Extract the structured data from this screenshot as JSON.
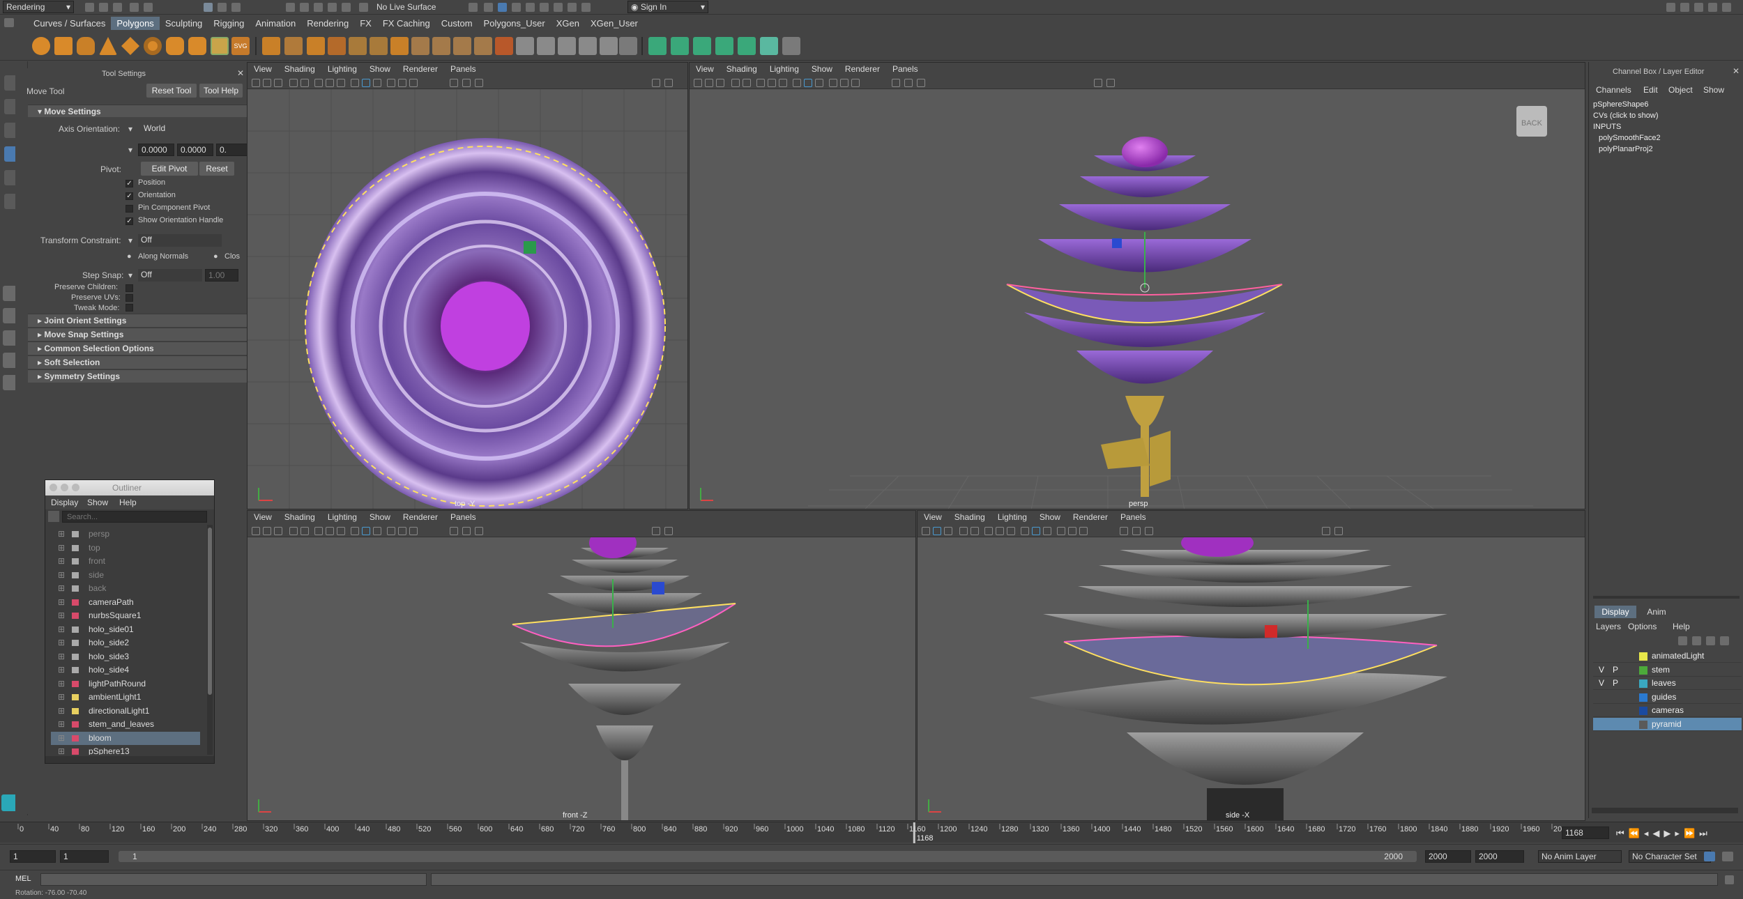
{
  "topbar": {
    "menu_set": "Rendering",
    "live_surface": "No Live Surface",
    "sign_in": "Sign In"
  },
  "shelf_tabs": [
    "Curves / Surfaces",
    "Polygons",
    "Sculpting",
    "Rigging",
    "Animation",
    "Rendering",
    "FX",
    "FX Caching",
    "Custom",
    "Polygons_User",
    "XGen",
    "XGen_User"
  ],
  "shelf_active": "Polygons",
  "tool_settings": {
    "header": "Tool Settings",
    "tool_name": "Move Tool",
    "reset_tool": "Reset Tool",
    "tool_help": "Tool Help",
    "section": "Move Settings",
    "axis_orientation_label": "Axis Orientation:",
    "axis_orientation": "World",
    "coord_x": "0.0000",
    "coord_y": "0.0000",
    "coord_z": "0.",
    "pivot_label": "Pivot:",
    "edit_pivot": "Edit Pivot",
    "reset": "Reset",
    "pivot_options": [
      "Position",
      "Orientation",
      "Pin Component Pivot",
      "Show Orientation Handle"
    ],
    "transform_constraint_label": "Transform Constraint:",
    "transform_constraint": "Off",
    "along_normals": "Along Normals",
    "closest": "Clos",
    "step_snap_label": "Step Snap:",
    "step_snap": "Off",
    "step_snap_value": "1.00",
    "preserve_children": "Preserve Children:",
    "preserve_uvs": "Preserve UVs:",
    "tweak_mode": "Tweak Mode:",
    "sections": [
      "Joint Orient Settings",
      "Move Snap Settings",
      "Common Selection Options",
      "Soft Selection",
      "Symmetry Settings"
    ]
  },
  "outliner": {
    "title": "Outliner",
    "menu": [
      "Display",
      "Show",
      "Help"
    ],
    "search_placeholder": "Search...",
    "items": [
      "persp",
      "top",
      "front",
      "side",
      "back",
      "cameraPath",
      "nurbsSquare1",
      "holo_side01",
      "holo_side2",
      "holo_side3",
      "holo_side4",
      "lightPathRound",
      "ambientLight1",
      "directionalLight1",
      "stem_and_leaves",
      "bloom",
      "pSphere13"
    ],
    "selected": "bloom"
  },
  "viewport_menu": [
    "View",
    "Shading",
    "Lighting",
    "Show",
    "Renderer",
    "Panels"
  ],
  "viewports": {
    "top": "top -Y",
    "persp": "persp",
    "front": "front -Z",
    "side": "side -X",
    "cube": "BACK"
  },
  "channel_box": {
    "title": "Channel Box / Layer Editor",
    "menu": [
      "Channels",
      "Edit",
      "Object",
      "Show"
    ],
    "lines": [
      "pSphereShape6",
      "CVs (click to show)",
      "INPUTS",
      "polySmoothFace2",
      "polyPlanarProj2"
    ]
  },
  "layer_editor": {
    "tabs": [
      "Display",
      "Anim"
    ],
    "menu": [
      "Layers",
      "Options",
      "Help"
    ],
    "layers": [
      {
        "v": "",
        "p": "",
        "name": "animatedLight",
        "color": "#e8e84a"
      },
      {
        "v": "V",
        "p": "P",
        "name": "stem",
        "color": "#4caa3a"
      },
      {
        "v": "V",
        "p": "P",
        "name": "leaves",
        "color": "#3aa8c0"
      },
      {
        "v": "",
        "p": "",
        "name": "guides",
        "color": "#2a7ad0"
      },
      {
        "v": "",
        "p": "",
        "name": "cameras",
        "color": "#1a4aa0"
      },
      {
        "v": "",
        "p": "",
        "name": "pyramid",
        "color": "#5a5a5a"
      }
    ],
    "selected": "pyramid"
  },
  "timeline": {
    "ticks": [
      "0",
      "40",
      "80",
      "120",
      "160",
      "200",
      "240",
      "280",
      "320",
      "360",
      "400",
      "440",
      "480",
      "520",
      "560",
      "600",
      "640",
      "680",
      "720",
      "760",
      "800",
      "840",
      "880",
      "920",
      "960",
      "1000",
      "1040",
      "1080",
      "1120",
      "1160",
      "1200",
      "1240",
      "1280",
      "1320",
      "1360",
      "1400",
      "1440",
      "1480",
      "1520",
      "1560",
      "1600",
      "1640",
      "1680",
      "1720",
      "1760",
      "1800",
      "1840",
      "1880",
      "1920",
      "1960",
      "20"
    ],
    "current_frame": "1168",
    "current_display": "1168",
    "start": "1",
    "start2": "1",
    "range_start": "1",
    "range_end": "2000",
    "end1": "2000",
    "end2": "2000",
    "anim_layer": "No Anim Layer",
    "char_set": "No Character Set"
  },
  "commandline": {
    "mel": "MEL",
    "help_line": "Rotation: -76.00   -70.40"
  }
}
